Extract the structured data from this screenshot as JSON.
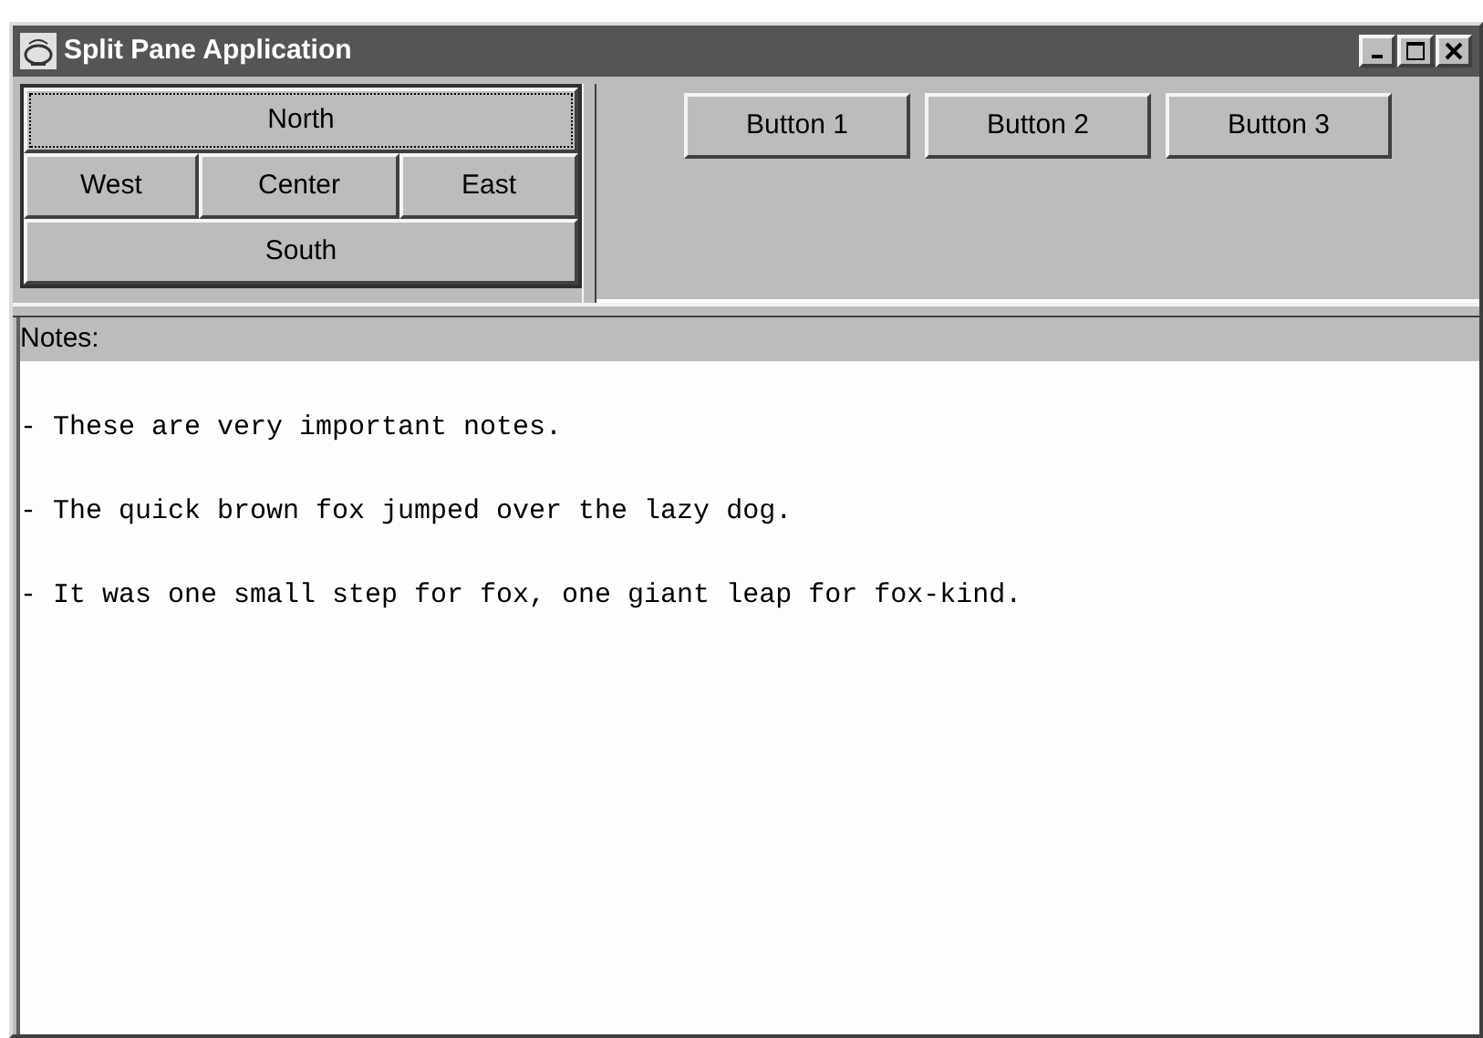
{
  "window": {
    "title": "Split Pane Application",
    "controls": [
      {
        "kind": "minimize"
      },
      {
        "kind": "maximize"
      },
      {
        "kind": "close"
      }
    ]
  },
  "left_pane": {
    "buttons": [
      {
        "label": "North",
        "focused": true
      },
      {
        "label": "West",
        "focused": false
      },
      {
        "label": "Center",
        "focused": false
      },
      {
        "label": "East",
        "focused": false
      },
      {
        "label": "South",
        "focused": false
      }
    ]
  },
  "right_pane": {
    "buttons": [
      "Button 1",
      "Button 2",
      "Button 3"
    ]
  },
  "notes": {
    "label": "Notes:",
    "lines": [
      "- These are very important notes.",
      "- The quick brown fox jumped over the lazy dog.",
      "- It was one small step for fox, one giant leap for fox-kind."
    ]
  }
}
